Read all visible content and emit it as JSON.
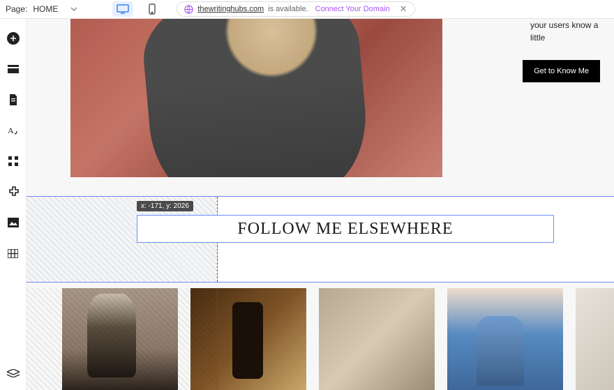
{
  "topbar": {
    "page_label": "Page:",
    "page_name": "HOME",
    "domain": "thewritinghubs.com",
    "available_text": "is available.",
    "connect_text": "Connect Your Domain"
  },
  "sidebar_icons": [
    "add",
    "section",
    "page",
    "theme",
    "apps",
    "addons",
    "media",
    "data",
    "layers"
  ],
  "about": {
    "line1": "",
    "line2": "your users know a little"
  },
  "cta_label": "Get to Know Me",
  "selection": {
    "coords": "x: -171, y: 2026",
    "heading": "FOLLOW ME ELSEWHERE"
  },
  "gallery": {
    "items": [
      "woman-sitting",
      "wine-table",
      "trenchcoat",
      "jeans-street",
      "architecture"
    ]
  }
}
